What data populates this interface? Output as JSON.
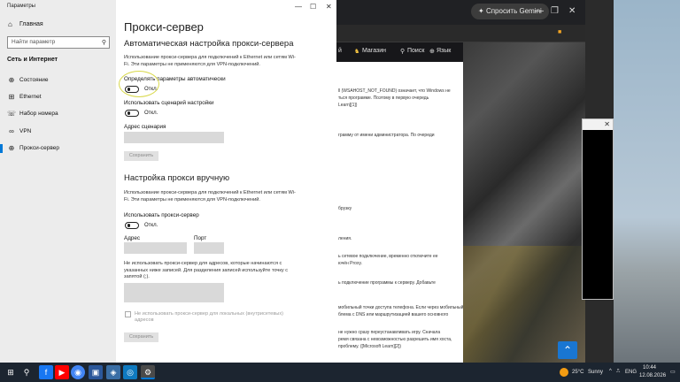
{
  "browser": {
    "gemini_button": "Спросить Gemini",
    "bookmark_shop": "Магазин",
    "nav_search": "Поиск",
    "nav_language": "Язык",
    "article_lines": [
      "ll (WSAHOST_NOT_FOUND) означает, что Windows не",
      "ться программе. Поэтому в первую очередь",
      "Learn][1])",
      "грамму от имени администратора. По очереди",
      "брузку",
      "ления.",
      "ь сетевое подключение, временно отключите ее",
      "ючён Proxy.",
      "ь подключение программы к серверу. Добавьте",
      "мобильный точки доступа телефона. Если через мобильный",
      "блема с DNS или маршрутизацией вашего основного",
      "не нужно сразу переустанавливать игру. Сначала",
      "ремя связана с невозможностью разрешить имя хоста,",
      "проблему. ([Microsoft Learn][2])"
    ]
  },
  "settings": {
    "app_title": "Параметры",
    "home_label": "Главная",
    "search_placeholder": "Найти параметр",
    "section_title": "Сеть и Интернет",
    "nav_items": [
      {
        "label": "Состояние",
        "icon": "globe-icon"
      },
      {
        "label": "Ethernet",
        "icon": "ethernet-icon"
      },
      {
        "label": "Набор номера",
        "icon": "phone-icon"
      },
      {
        "label": "VPN",
        "icon": "vpn-icon"
      },
      {
        "label": "Прокси-сервер",
        "icon": "globe-icon"
      }
    ],
    "page_title": "Прокси-сервер",
    "auto_section": {
      "heading": "Автоматическая настройка прокси-сервера",
      "description": "Использование прокси-сервера для подключений к Ethernet или сетям Wi-Fi. Эти параметры не применяются для VPN-подключений.",
      "detect_label": "Определять параметры автоматически",
      "detect_state": "Откл.",
      "script_label": "Использовать сценарий настройки",
      "script_state": "Откл.",
      "address_label": "Адрес сценария",
      "save_label": "Сохранить"
    },
    "manual_section": {
      "heading": "Настройка прокси вручную",
      "description": "Использование прокси-сервера для подключений к Ethernet или сетям Wi-Fi. Эти параметры не применяются для VPN-подключений.",
      "use_proxy_label": "Использовать прокси-сервер",
      "use_proxy_state": "Откл.",
      "address_label": "Адрес",
      "port_label": "Порт",
      "exceptions_desc": "Не использовать прокси-сервер для адресов, которые начинаются с указанных ниже записей. Для разделения записей используйте точку с запятой (;).",
      "local_checkbox": "Не использовать прокси-сервер для локальных (внутрисетевых) адресов",
      "save_label": "Сохранить"
    }
  },
  "taskbar": {
    "weather": "25°C",
    "weather_desc": "Sunny",
    "language": "ENG",
    "time": "10:44",
    "date": "12.08.2026"
  },
  "colors": {
    "accent": "#0078d7",
    "taskbar": "#1c2530",
    "sidebar": "#ececec"
  }
}
